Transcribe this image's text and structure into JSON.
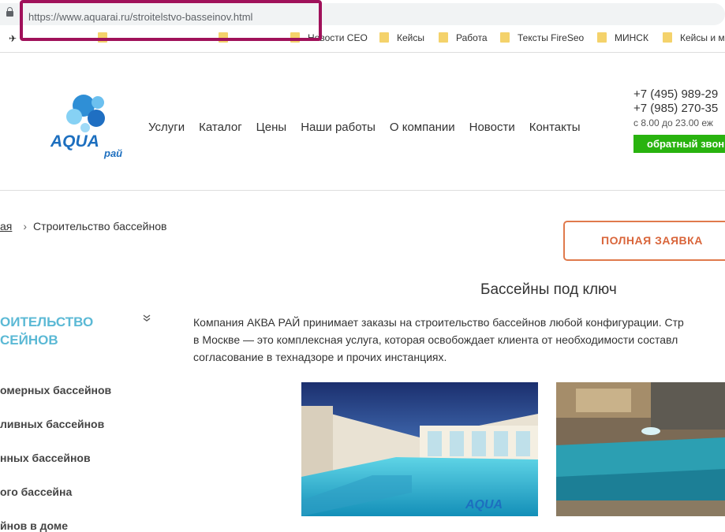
{
  "browser": {
    "url": "https://www.aquarai.ru/stroitelstvo-basseinov.html",
    "bookmarks": [
      {
        "label": "Новости СЕО"
      },
      {
        "label": "Кейсы"
      },
      {
        "label": "Работа"
      },
      {
        "label": "Тексты FireSeo"
      },
      {
        "label": "МИНСК"
      },
      {
        "label": "Кейсы и м"
      }
    ]
  },
  "header": {
    "logo_text": "AQUA",
    "logo_sub": "рай",
    "nav": [
      "Услуги",
      "Каталог",
      "Цены",
      "Наши работы",
      "О компании",
      "Новости",
      "Контакты"
    ],
    "phone1": "+7 (495) 989-29",
    "phone2": "+7 (985) 270-35",
    "hours": "с 8.00 до 23.00 еж",
    "callback_label": "обратный звон"
  },
  "breadcrumb": {
    "home": "ая",
    "separator": "›",
    "current": "Строительство бассейнов"
  },
  "request_button": "ПОЛНАЯ ЗАЯВКА",
  "page_title": "Бассейны под ключ",
  "sidebar": {
    "heading_line1": "ОИТЕЛЬСТВО",
    "heading_line2": "СЕЙНОВ",
    "items": [
      "омерных бассейнов",
      "ливных бассейнов",
      "нных бассейнов",
      "ого бассейна",
      "йнов в доме"
    ]
  },
  "intro": [
    "Компания АКВА РАЙ принимает заказы на строительство бассейнов любой конфигурации. Стр",
    "в Москве — это комплексная услуга, которая освобождает клиента от необходимости составл",
    "согласование в технадзоре и прочих инстанциях."
  ],
  "colors": {
    "accent_blue": "#5bb9d5",
    "callback_green": "#29b30f",
    "request_orange": "#e07a4c",
    "highlight": "#a0115a"
  }
}
